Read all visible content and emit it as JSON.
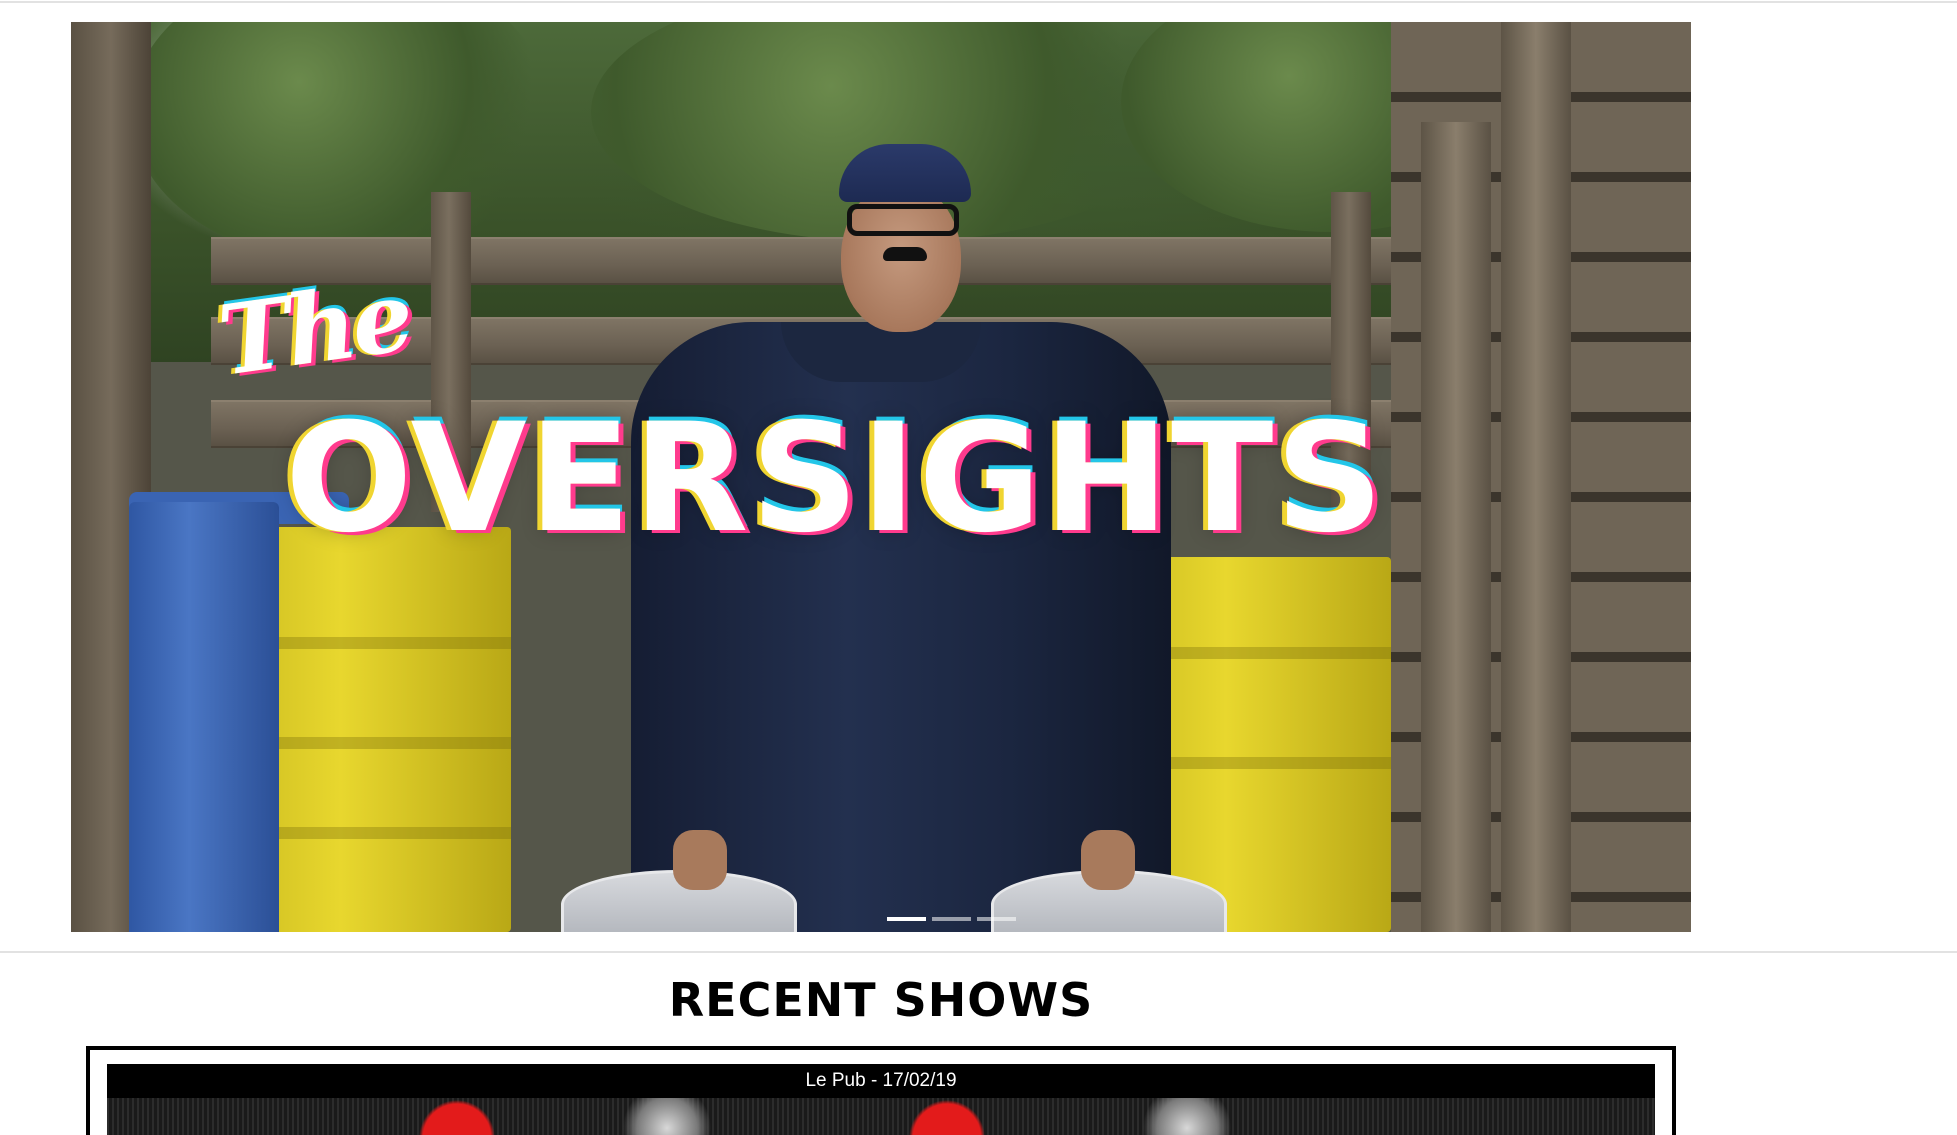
{
  "hero": {
    "title_small": "The",
    "title_big": "OVERSIGHTS",
    "fullscreen_icon": "scan-icon",
    "slides": [
      {
        "active": true
      },
      {
        "active": false
      },
      {
        "active": false
      }
    ]
  },
  "recent_shows": {
    "heading": "RECENT SHOWS",
    "items": [
      {
        "caption": "Le Pub - 17/02/19"
      }
    ]
  },
  "colors": {
    "accent_cyan": "#23c6e8",
    "accent_magenta": "#ff3b8d",
    "accent_yellow": "#f0d531",
    "poster_red": "#e31b1b"
  }
}
